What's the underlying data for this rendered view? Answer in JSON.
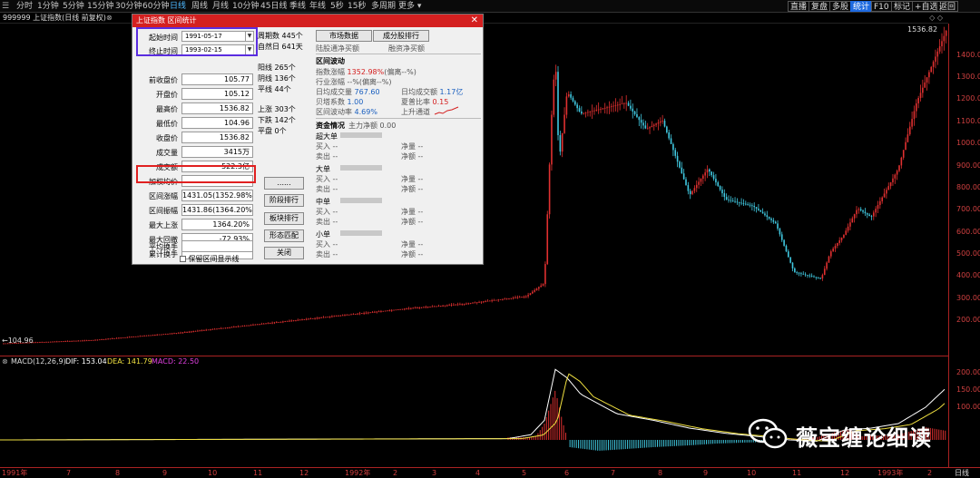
{
  "toolbar": {
    "left_items": [
      "分时",
      "1分钟",
      "5分钟",
      "15分钟",
      "30分钟",
      "60分钟",
      "日线",
      "周线",
      "月线",
      "10分钟",
      "45日线",
      "季线",
      "年线",
      "5秒",
      "15秒",
      "多周期",
      "更多"
    ],
    "selected": "日线",
    "right_items": [
      "直播",
      "复盘",
      "多股",
      "统计",
      "F10",
      "标记",
      "+自选",
      "返回"
    ],
    "right_selected": "统计"
  },
  "info": {
    "text": "999999 上证指数(日线 前复权)",
    "close": "⊗",
    "diamonds": "◇ ◇"
  },
  "chart": {
    "last_price": "1536.82",
    "low_price_tag": "←104.96",
    "y_labels": [
      "1400.00",
      "1300.00",
      "1200.00",
      "1100.00",
      "1000.00",
      "900.00",
      "800.00",
      "700.00",
      "600.00",
      "500.00",
      "400.00",
      "300.00",
      "200.00"
    ],
    "up_color": "#e03030",
    "down_color": "#40c8e0"
  },
  "macd": {
    "label": "MACD(12,26,9)",
    "dif": "DIF: 153.04",
    "dea": "DEA: 141.79",
    "macd": "MACD: 22.50",
    "y_labels": [
      "200.00",
      "150.00",
      "100.00"
    ]
  },
  "x_axis": {
    "labels": [
      "1991年",
      "7",
      "8",
      "9",
      "10",
      "11",
      "12",
      "1992年",
      "2",
      "3",
      "4",
      "5",
      "6",
      "7",
      "8",
      "9",
      "10",
      "11",
      "12",
      "1993年",
      "2"
    ],
    "end_label": "日线"
  },
  "watermark": {
    "text": "薇宝缠论细读"
  },
  "dialog": {
    "title": "上证指数 区间统计",
    "close": "✕",
    "start_label": "起始时间",
    "start_value": "1991-05-17",
    "end_label": "终止时间",
    "end_value": "1993-02-15",
    "rows": [
      {
        "label": "前收盘价",
        "value": "105.77"
      },
      {
        "label": "开盘价",
        "value": "105.12"
      },
      {
        "label": "最高价",
        "value": "1536.82"
      },
      {
        "label": "最低价",
        "value": "104.96"
      },
      {
        "label": "收盘价",
        "value": "1536.82"
      },
      {
        "label": "成交量",
        "value": "3415万"
      },
      {
        "label": "成交额",
        "value": "522.3亿"
      },
      {
        "label": "加权均价",
        "value": ""
      },
      {
        "label": "区间涨幅",
        "value": "1431.05(1352.98%)"
      },
      {
        "label": "区间振幅",
        "value": "1431.86(1364.20%)"
      },
      {
        "label": "最大上涨",
        "value": "1364.20%"
      },
      {
        "label": "最大回撤",
        "value": "-72.93%"
      },
      {
        "label": "累计换手",
        "value": ""
      },
      {
        "label": "平均换手",
        "value": ""
      }
    ],
    "checkbox_label": "保留区间显示线",
    "period_count": "周期数 445个",
    "natural_days": "自然日 641天",
    "yang": "阳线 265个",
    "yin": "阴线 136个",
    "ping": "平线 44个",
    "up_count": "上涨 303个",
    "down_count": "下跌 142个",
    "flat_count": "平盘 0个",
    "tab1": "市场数据",
    "tab2": "成分股排行",
    "buttons": [
      "......",
      "阶段排行",
      "板块排行",
      "形态匹配",
      "关闭"
    ],
    "north_flow": "陆股通净买额",
    "margin": "融资净买额",
    "range_section": "区间波动",
    "idx_change_label": "指数涨幅",
    "idx_change_value": "1352.98%",
    "idx_change_extra": "(偏离--%)",
    "ind_change": "行业涨幅 --%(偏离--%)",
    "avg_turnover_label": "日均成交量",
    "avg_turnover_value": "767.60",
    "avg_amount_label": "日均成交额",
    "avg_amount_value": "1.17亿",
    "beta_label": "贝塔系数",
    "beta_value": "1.00",
    "sharpe_label": "夏普比率",
    "sharpe_value": "0.15",
    "volatility_label": "区间波动率",
    "volatility_value": "4.69%",
    "channel_label": "上升通道",
    "capital": "资金情况",
    "main_net": "主力净额 0.00",
    "groups": [
      {
        "name": "超大单",
        "buy": "买入 --",
        "sell": "卖出 --",
        "net": "净量 --",
        "netamt": "净额 --"
      },
      {
        "name": "大单",
        "buy": "买入 --",
        "sell": "卖出 --",
        "net": "净量 --",
        "netamt": "净额 --"
      },
      {
        "name": "中单",
        "buy": "买入 --",
        "sell": "卖出 --",
        "net": "净量 --",
        "netamt": "净额 --"
      },
      {
        "name": "小单",
        "buy": "买入 --",
        "sell": "卖出 --",
        "net": "净量 --",
        "netamt": "净额 --"
      }
    ]
  }
}
